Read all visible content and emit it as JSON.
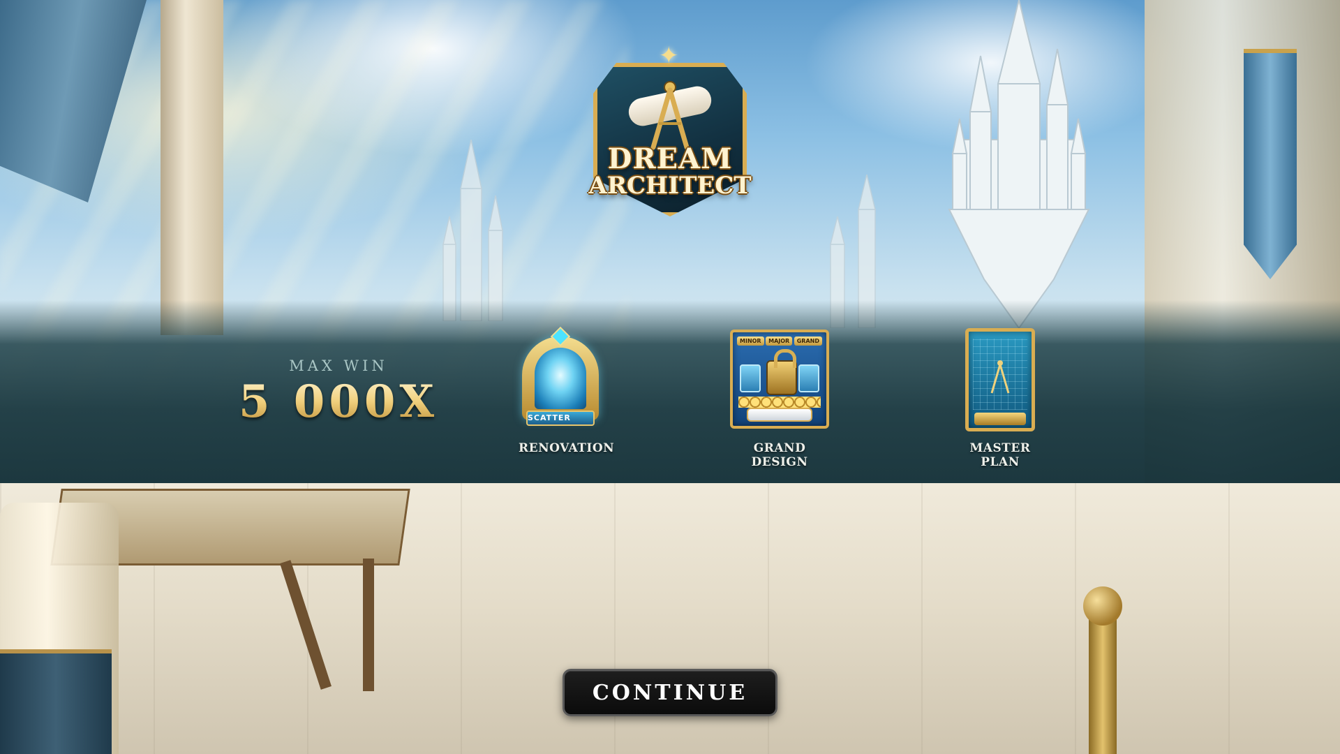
{
  "logo": {
    "line1": "DREAM",
    "line2": "ARCHITECT",
    "icon": "compass-scroll-emblem-icon"
  },
  "max_win": {
    "label": "MAX WIN",
    "value": "5 000X"
  },
  "features": [
    {
      "label": "RENOVATION",
      "icon": "portal-scatter-icon",
      "badge": "SCATTER"
    },
    {
      "label": "GRAND DESIGN",
      "icon": "locked-chest-jackpot-icon",
      "tags": [
        "MINOR",
        "MAJOR",
        "GRAND"
      ]
    },
    {
      "label": "MASTER PLAN",
      "icon": "blueprint-card-icon"
    }
  ],
  "continue_button": {
    "label": "CONTINUE"
  },
  "colors": {
    "band": "#173a42",
    "gold": "#d9ad52",
    "button": "#111111"
  }
}
